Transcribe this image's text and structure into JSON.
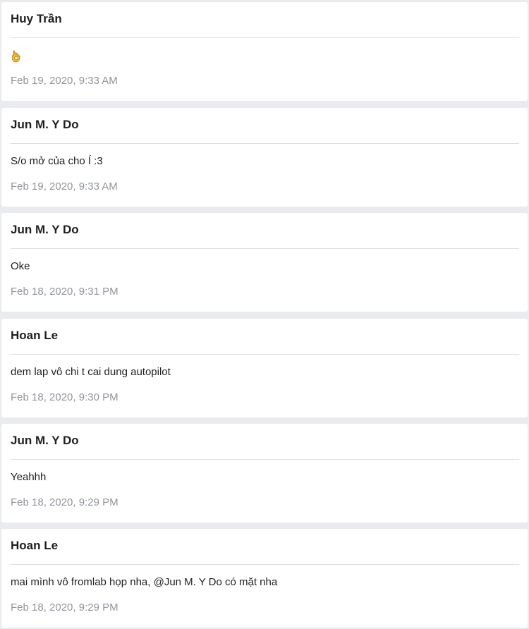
{
  "messages": [
    {
      "author": "Huy Trần",
      "text": "",
      "icon": "ok-hand-icon",
      "timestamp": "Feb 19, 2020, 9:33 AM"
    },
    {
      "author": "Jun M. Y Do",
      "text": "S/o mở của cho Í :3",
      "timestamp": "Feb 19, 2020, 9:33 AM"
    },
    {
      "author": "Jun M. Y Do",
      "text": "Oke",
      "timestamp": "Feb 18, 2020, 9:31 PM"
    },
    {
      "author": "Hoan Le",
      "text": "dem lap vô chi t cai dung autopilot",
      "timestamp": "Feb 18, 2020, 9:30 PM"
    },
    {
      "author": "Jun M. Y Do",
      "text": "Yeahhh",
      "timestamp": "Feb 18, 2020, 9:29 PM"
    },
    {
      "author": "Hoan Le",
      "text": "mai mình vô fromlab họp nha, @Jun M. Y Do có mặt nha",
      "timestamp": "Feb 18, 2020, 9:29 PM"
    }
  ],
  "colors": {
    "background": "#e9ebee",
    "card": "#ffffff",
    "author": "#1c1e21",
    "timestamp": "#90949c",
    "divider": "#dddfe2",
    "emoji": "#f5b82e"
  }
}
